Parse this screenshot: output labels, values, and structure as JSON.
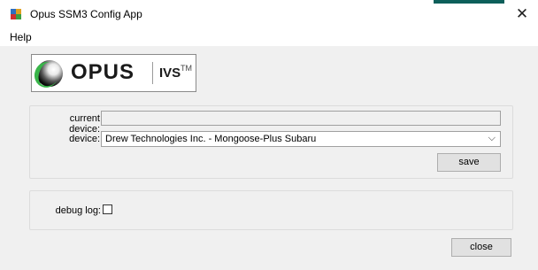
{
  "window": {
    "title": "Opus SSM3 Config App",
    "close_glyph": "✕",
    "icon": "app-window-icon"
  },
  "menu": {
    "items": [
      {
        "label": "Help"
      }
    ]
  },
  "logo": {
    "brand": "OPUS",
    "sub": "IVS",
    "tm": "TM",
    "icon": "opus-logo-icon"
  },
  "device_group": {
    "current_device_label": "current device:",
    "current_device_value": "",
    "device_label": "device:",
    "device_value": "Drew Technologies Inc. - Mongoose-Plus Subaru",
    "chevron_glyph": "⌵",
    "save_label": "save"
  },
  "debug_group": {
    "debug_label": "debug log:",
    "debug_checked": false
  },
  "footer": {
    "close_label": "close"
  },
  "colors": {
    "client_bg": "#f0f0f0",
    "button_bg": "#e1e1e1",
    "logo_green": "#39b54a"
  }
}
